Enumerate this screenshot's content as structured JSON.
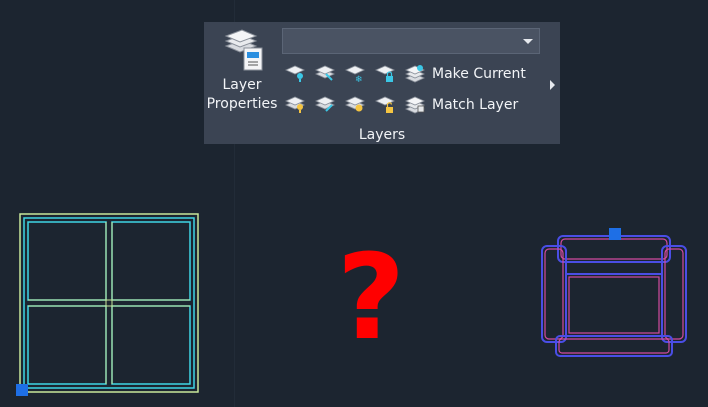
{
  "ribbon": {
    "panel_title": "Layers",
    "layer_dropdown": {
      "value": ""
    },
    "layer_properties": {
      "line1": "Layer",
      "line2": "Properties",
      "icon": "layer-properties-icon"
    },
    "row1": {
      "tools": [
        "layer-off-icon",
        "layer-isolate-icon",
        "layer-freeze-icon",
        "layer-lock-icon",
        "make-current-icon"
      ],
      "label": "Make Current"
    },
    "row2": {
      "tools": [
        "layer-on-icon",
        "layer-unisolate-icon",
        "layer-thaw-icon",
        "layer-unlock-icon",
        "match-layer-icon"
      ],
      "label": "Match Layer"
    }
  },
  "canvas": {
    "question_mark": "?",
    "colors": {
      "background": "#1c2530",
      "window_outline": "#c8e89a",
      "window_inner": "#3fd7e6",
      "chair_outline": "#4a4ee6",
      "chair_inner": "#d24ba0",
      "grip": "#1e6fe6",
      "question": "#ff0000"
    }
  }
}
